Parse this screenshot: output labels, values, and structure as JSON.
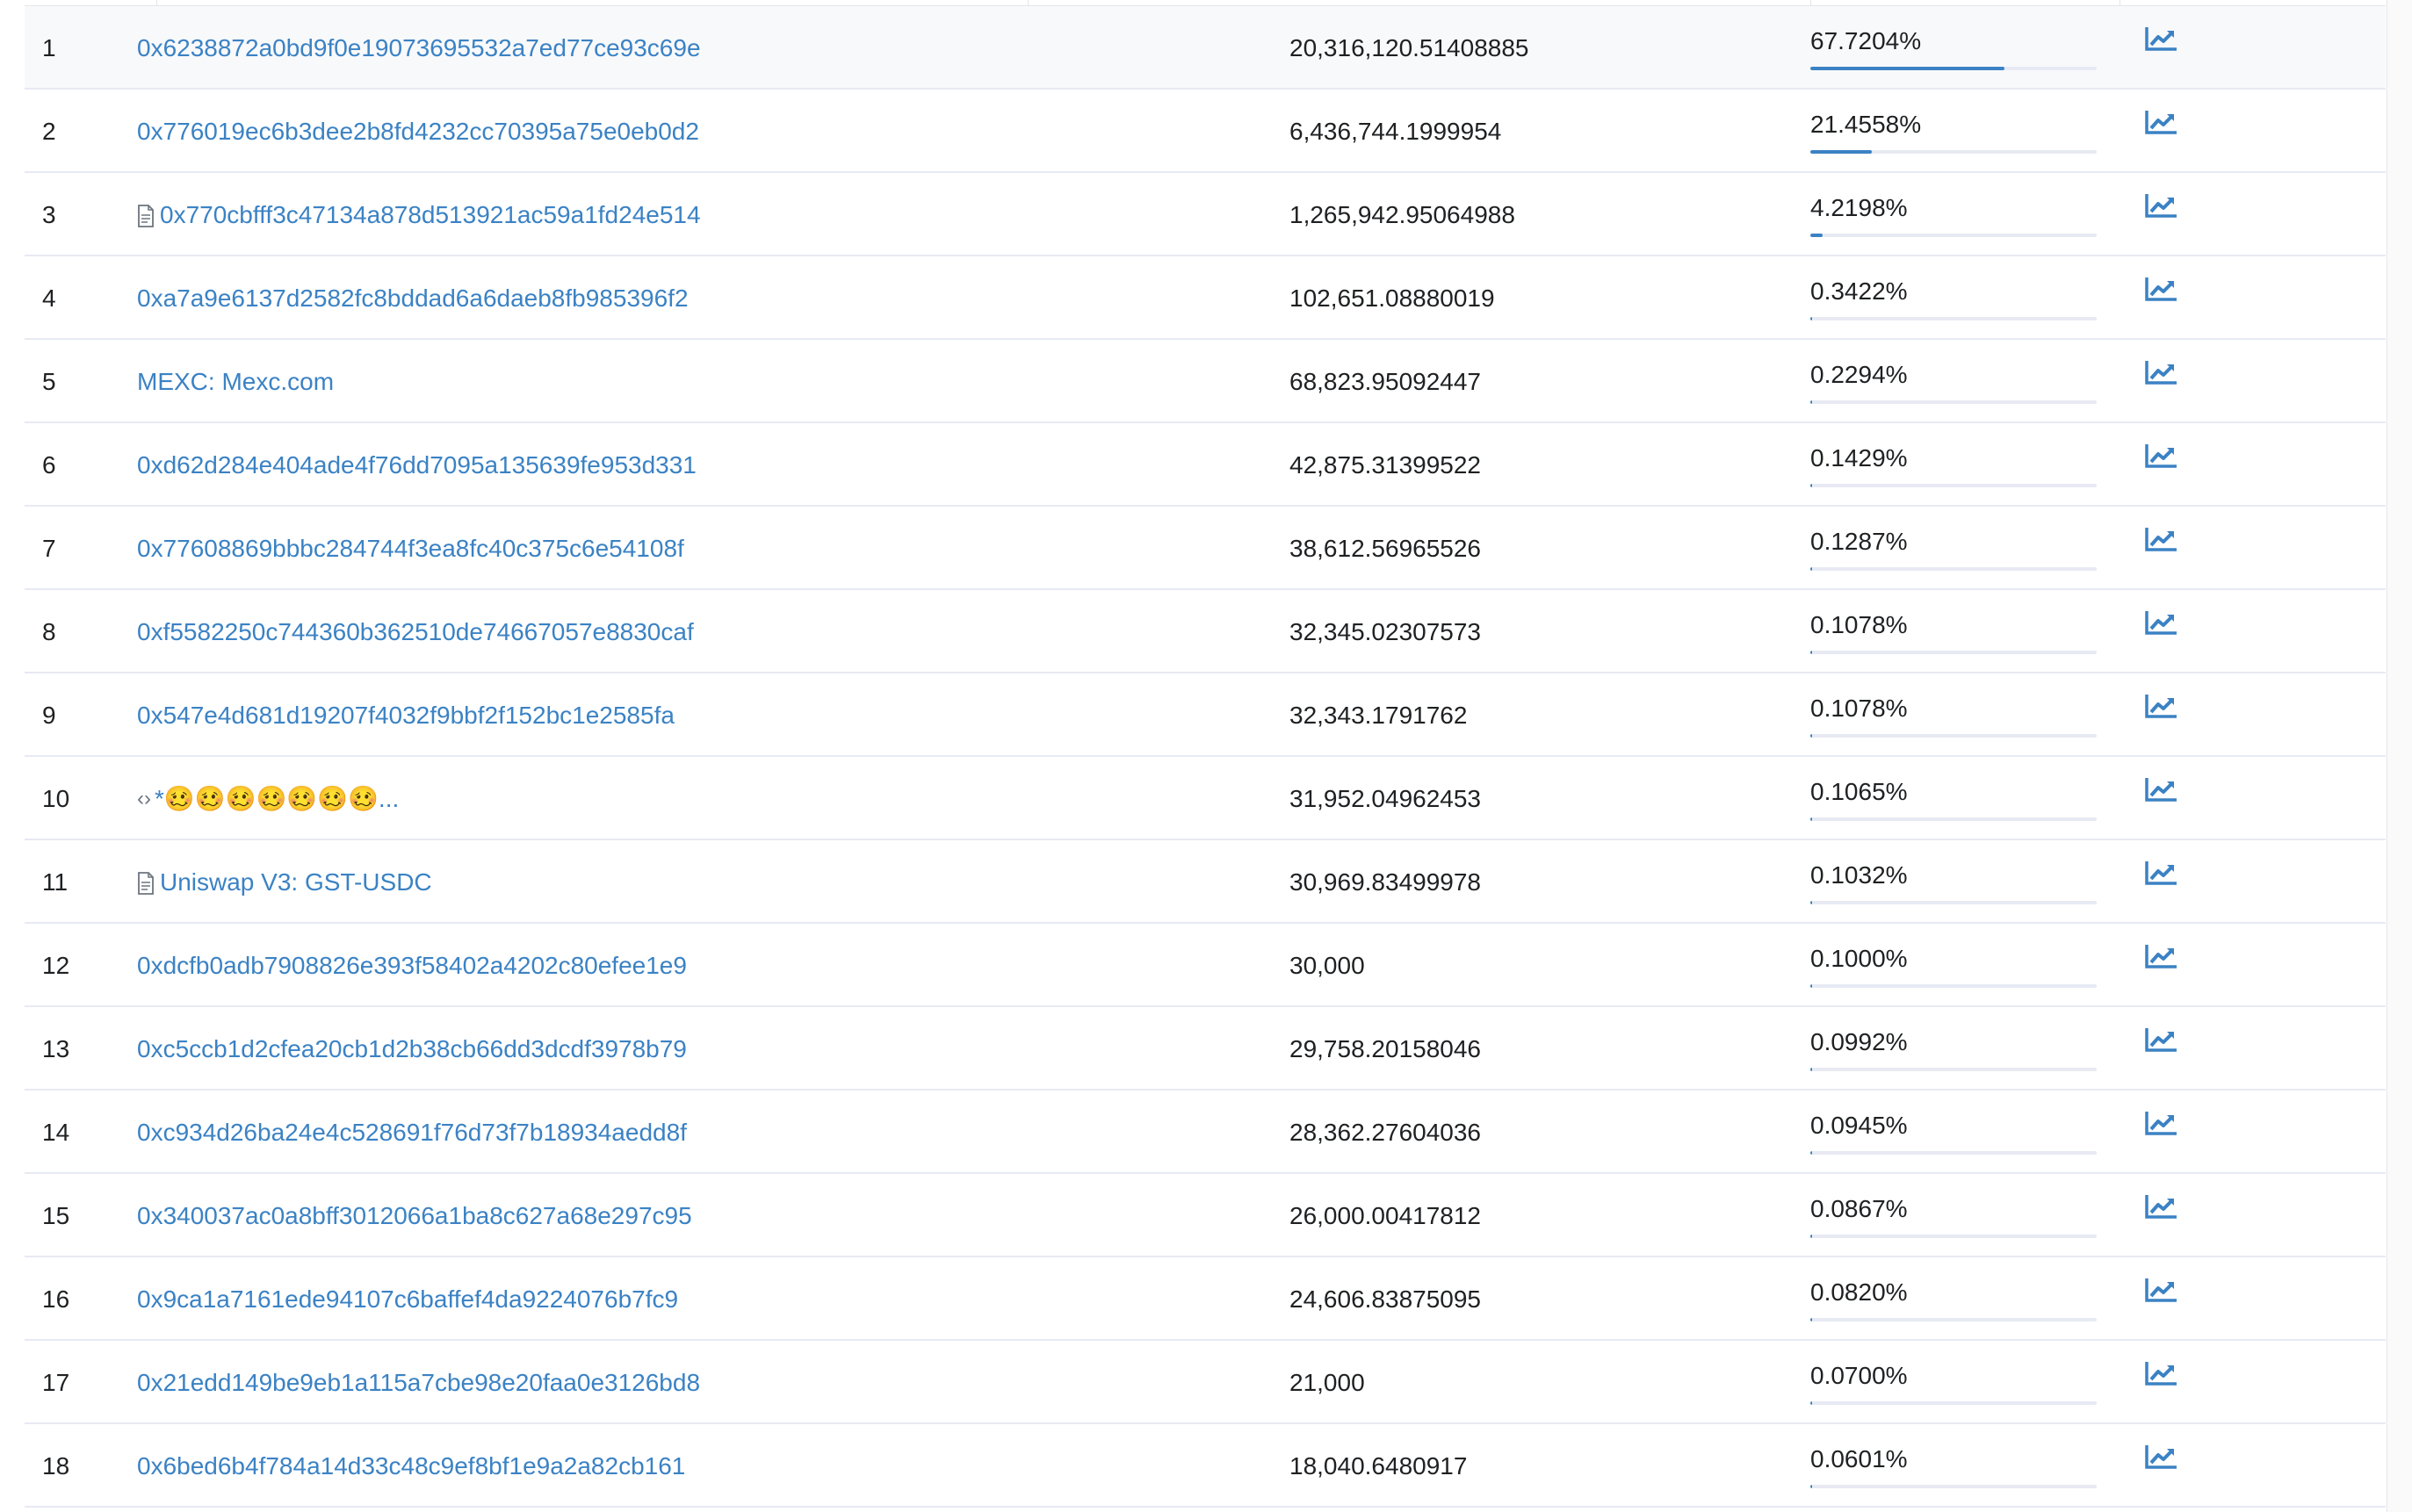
{
  "holders": [
    {
      "rank": "1",
      "address": "0x6238872a0bd9f0e19073695532a7ed77ce93c69e",
      "quantity": "20,316,120.51408885",
      "percentage": "67.7204%",
      "percent_value": 67.7204,
      "type": "address",
      "highlighted": true
    },
    {
      "rank": "2",
      "address": "0x776019ec6b3dee2b8fd4232cc70395a75e0eb0d2",
      "quantity": "6,436,744.1999954",
      "percentage": "21.4558%",
      "percent_value": 21.4558,
      "type": "address"
    },
    {
      "rank": "3",
      "address": "0x770cbfff3c47134a878d513921ac59a1fd24e514",
      "quantity": "1,265,942.95064988",
      "percentage": "4.2198%",
      "percent_value": 4.2198,
      "type": "contract-file"
    },
    {
      "rank": "4",
      "address": "0xa7a9e6137d2582fc8bddad6a6daeb8fb985396f2",
      "quantity": "102,651.08880019",
      "percentage": "0.3422%",
      "percent_value": 0.3422,
      "type": "address"
    },
    {
      "rank": "5",
      "address": "MEXC: Mexc.com",
      "quantity": "68,823.95092447",
      "percentage": "0.2294%",
      "percent_value": 0.2294,
      "type": "address"
    },
    {
      "rank": "6",
      "address": "0xd62d284e404ade4f76dd7095a135639fe953d331",
      "quantity": "42,875.31399522",
      "percentage": "0.1429%",
      "percent_value": 0.1429,
      "type": "address"
    },
    {
      "rank": "7",
      "address": "0x77608869bbbc284744f3ea8fc40c375c6e54108f",
      "quantity": "38,612.56965526",
      "percentage": "0.1287%",
      "percent_value": 0.1287,
      "type": "address"
    },
    {
      "rank": "8",
      "address": "0xf5582250c744360b362510de74667057e8830caf",
      "quantity": "32,345.02307573",
      "percentage": "0.1078%",
      "percent_value": 0.1078,
      "type": "address"
    },
    {
      "rank": "9",
      "address": "0x547e4d681d19207f4032f9bbf2f152bc1e2585fa",
      "quantity": "32,343.1791762",
      "percentage": "0.1078%",
      "percent_value": 0.1078,
      "type": "address"
    },
    {
      "rank": "10",
      "address": "*🥴🥴🥴🥴🥴🥴🥴...",
      "quantity": "31,952.04962453",
      "percentage": "0.1065%",
      "percent_value": 0.1065,
      "type": "contract-code",
      "emoji_count": 7
    },
    {
      "rank": "11",
      "address": "Uniswap V3: GST-USDC",
      "quantity": "30,969.83499978",
      "percentage": "0.1032%",
      "percent_value": 0.1032,
      "type": "contract-file"
    },
    {
      "rank": "12",
      "address": "0xdcfb0adb7908826e393f58402a4202c80efee1e9",
      "quantity": "30,000",
      "percentage": "0.1000%",
      "percent_value": 0.1,
      "type": "address"
    },
    {
      "rank": "13",
      "address": "0xc5ccb1d2cfea20cb1d2b38cb66dd3dcdf3978b79",
      "quantity": "29,758.20158046",
      "percentage": "0.0992%",
      "percent_value": 0.0992,
      "type": "address"
    },
    {
      "rank": "14",
      "address": "0xc934d26ba24e4c528691f76d73f7b18934aedd8f",
      "quantity": "28,362.27604036",
      "percentage": "0.0945%",
      "percent_value": 0.0945,
      "type": "address"
    },
    {
      "rank": "15",
      "address": "0x340037ac0a8bff3012066a1ba8c627a68e297c95",
      "quantity": "26,000.00417812",
      "percentage": "0.0867%",
      "percent_value": 0.0867,
      "type": "address"
    },
    {
      "rank": "16",
      "address": "0x9ca1a7161ede94107c6baffef4da9224076b7fc9",
      "quantity": "24,606.83875095",
      "percentage": "0.0820%",
      "percent_value": 0.082,
      "type": "address"
    },
    {
      "rank": "17",
      "address": "0x21edd149be9eb1a115a7cbe98e20faa0e3126bd8",
      "quantity": "21,000",
      "percentage": "0.0700%",
      "percent_value": 0.07,
      "type": "address"
    },
    {
      "rank": "18",
      "address": "0x6bed6b4f784a14d33c48c9ef8bf1e9a2a82cb161",
      "quantity": "18,040.6480917",
      "percentage": "0.0601%",
      "percent_value": 0.0601,
      "type": "address"
    }
  ],
  "icons": {
    "analytics": "chart-line-icon",
    "contract_file": "file-icon",
    "contract_code": "code-icon"
  },
  "colors": {
    "link": "#3b82c4",
    "bar_fill": "#3b82c4",
    "bar_track": "#e7eaf3",
    "row_border": "#e7eaf3",
    "highlight_row": "#f8f9fb"
  }
}
